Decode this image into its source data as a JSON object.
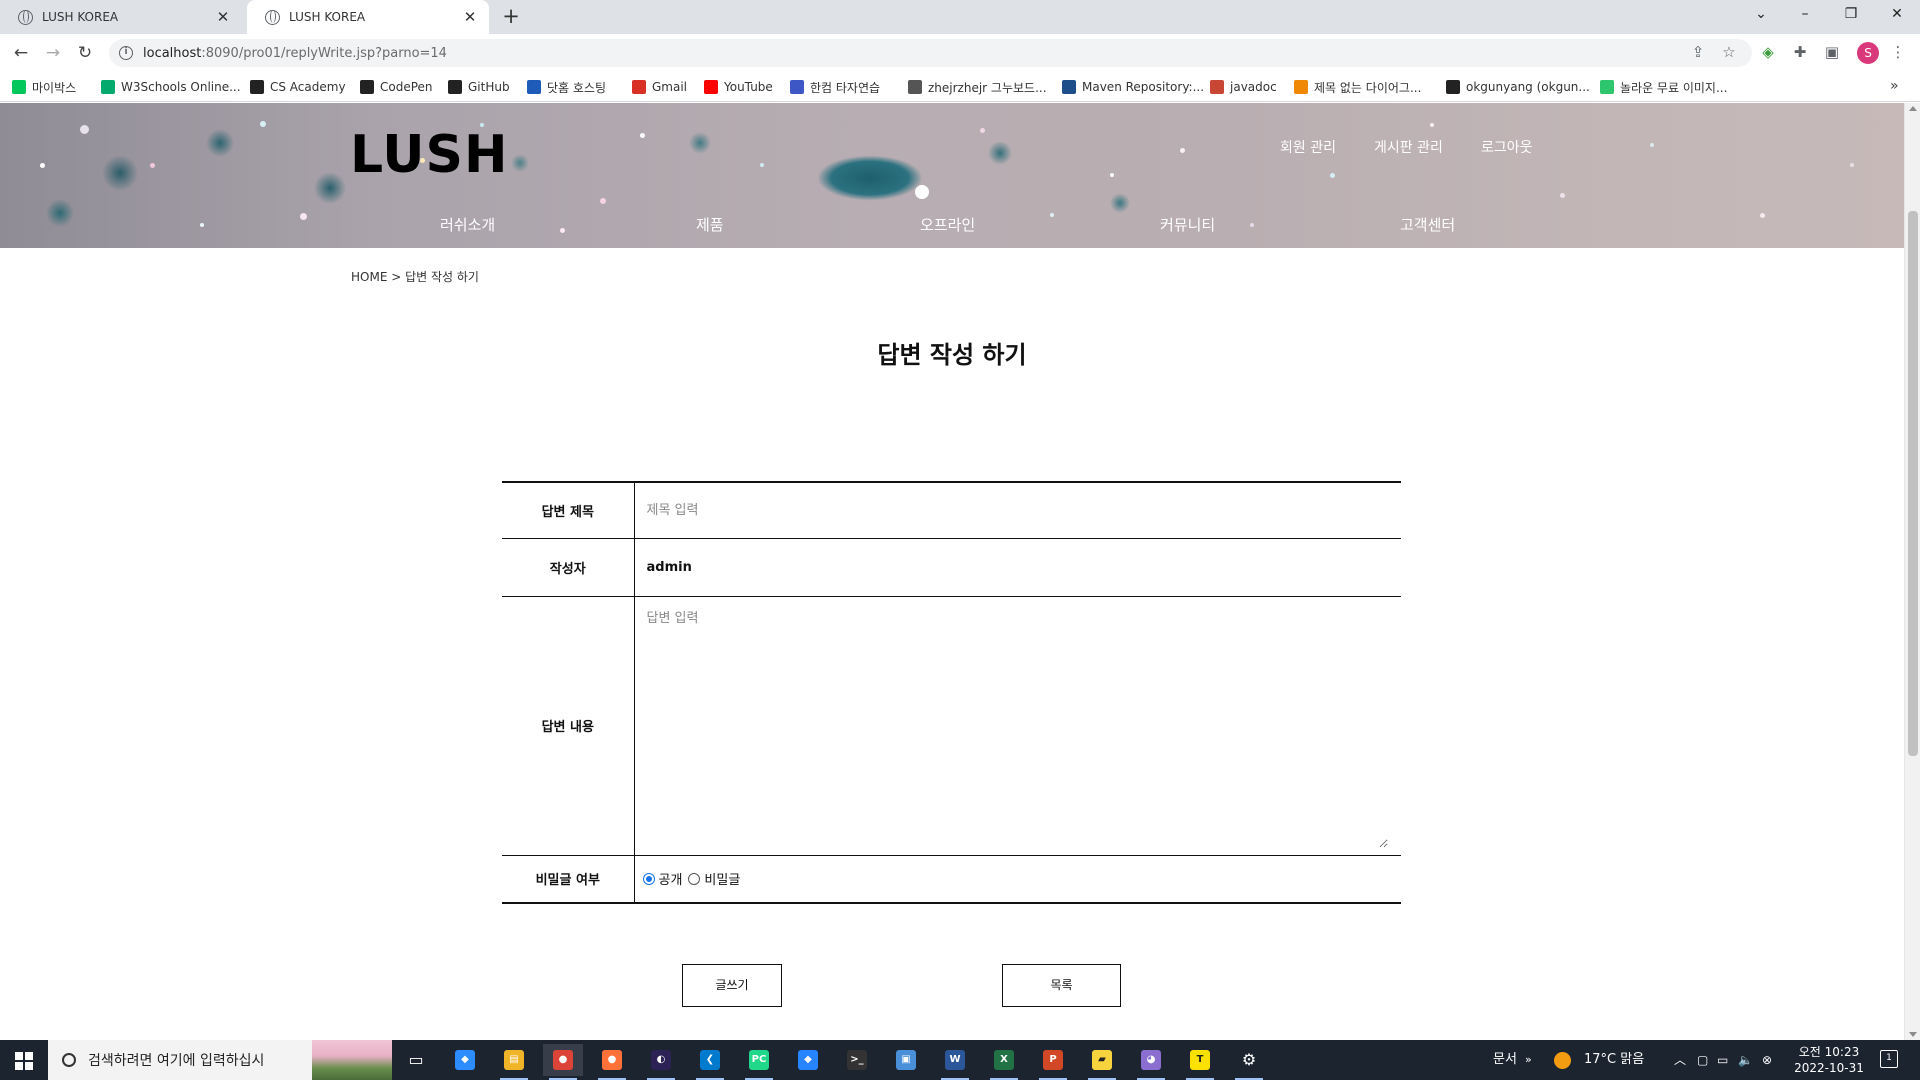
{
  "browser": {
    "tabs": [
      {
        "title": "LUSH KOREA",
        "active": false
      },
      {
        "title": "LUSH KOREA",
        "active": true
      }
    ],
    "url_host": "localhost",
    "url_path": ":8090/pro01/replyWrite.jsp?parno=14",
    "profile_initial": "S",
    "bookmarks": [
      {
        "label": "마이박스",
        "icon": "naver-mybox-icon",
        "color": "#03c75a"
      },
      {
        "label": "W3Schools Online...",
        "icon": "w3schools-icon",
        "color": "#04aa6d"
      },
      {
        "label": "CS Academy",
        "icon": "cs-academy-icon",
        "color": "#222222"
      },
      {
        "label": "CodePen",
        "icon": "codepen-icon",
        "color": "#222222"
      },
      {
        "label": "GitHub",
        "icon": "github-icon",
        "color": "#222222"
      },
      {
        "label": "닷홈 호스팅",
        "icon": "dothome-icon",
        "color": "#1e5bb8"
      },
      {
        "label": "Gmail",
        "icon": "gmail-icon",
        "color": "#d93025"
      },
      {
        "label": "YouTube",
        "icon": "youtube-icon",
        "color": "#ff0000"
      },
      {
        "label": "한컴 타자연습",
        "icon": "hancom-icon",
        "color": "#3d57c4"
      },
      {
        "label": "zhejrzhejr 그누보드...",
        "icon": "globe-icon",
        "color": "#555555"
      },
      {
        "label": "Maven Repository:...",
        "icon": "maven-icon",
        "color": "#1d4e89"
      },
      {
        "label": "javadoc",
        "icon": "oracle-icon",
        "color": "#c74634"
      },
      {
        "label": "제목 없는 다이어그...",
        "icon": "drawio-icon",
        "color": "#f08705"
      },
      {
        "label": "okgunyang (okgun...",
        "icon": "github-icon",
        "color": "#222222"
      },
      {
        "label": "놀라운 무료 이미지...",
        "icon": "pixabay-icon",
        "color": "#2ec66d"
      }
    ]
  },
  "site": {
    "logo": "LUSH",
    "util_nav": [
      "회원 관리",
      "게시판 관리",
      "로그아웃"
    ],
    "gnb": [
      "러쉬소개",
      "제품",
      "오프라인",
      "커뮤니티",
      "고객센터"
    ],
    "breadcrumb": "HOME > 답변 작성 하기",
    "page_title": "답변 작성 하기"
  },
  "form": {
    "title_label": "답변 제목",
    "title_placeholder": "제목 입력",
    "title_value": "",
    "writer_label": "작성자",
    "writer_value": "admin",
    "content_label": "답변 내용",
    "content_placeholder": "답변 입력",
    "content_value": "",
    "secret_label": "비밀글 여부",
    "secret_options": [
      {
        "label": "공개",
        "checked": true
      },
      {
        "label": "비밀글",
        "checked": false
      }
    ],
    "submit_label": "글쓰기",
    "list_label": "목록"
  },
  "taskbar": {
    "search_placeholder": "검색하려면 여기에 입력하십시",
    "apps": [
      "task-view-icon",
      "zoom-files-icon",
      "file-explorer-icon",
      "chrome-icon",
      "firefox-icon",
      "eclipse-icon",
      "vscode-icon",
      "pycharm-icon",
      "sourcetree-icon",
      "terminal-icon",
      "photo-icon",
      "word-icon",
      "excel-icon",
      "powerpoint-icon",
      "sticky-notes-icon",
      "paint-icon",
      "kakaotalk-icon",
      "settings-icon"
    ],
    "tray_docs": "문서",
    "weather": "17°C  맑음",
    "time": "오전 10:23",
    "date": "2022-10-31",
    "notifications": "1"
  }
}
